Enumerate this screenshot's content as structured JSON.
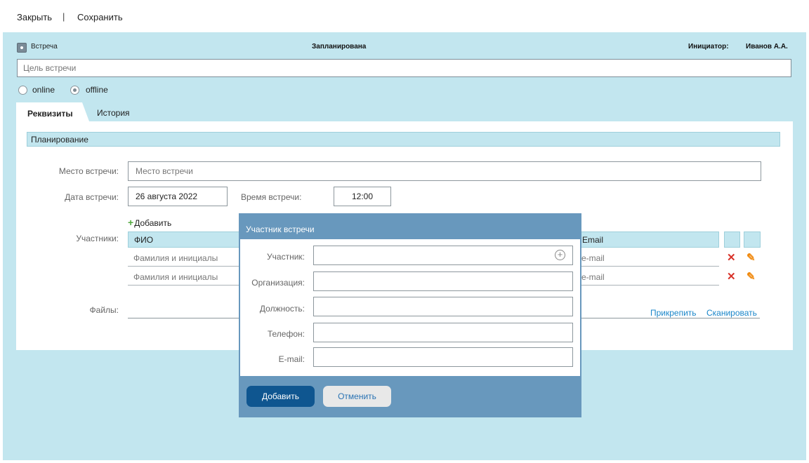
{
  "toolbar": {
    "close_label": "Закрыть",
    "separator": "|",
    "save_label": "Сохранить"
  },
  "header": {
    "doc_type": "Встреча",
    "status": "Запланирована",
    "initiator_label": "Инициатор:",
    "initiator_value": "Иванов А.А."
  },
  "purpose": {
    "placeholder": "Цель встречи",
    "value": ""
  },
  "format": {
    "options": [
      {
        "label": "online",
        "checked": false
      },
      {
        "label": "offline",
        "checked": true
      }
    ]
  },
  "tabs": [
    {
      "label": "Реквизиты",
      "active": true
    },
    {
      "label": "История",
      "active": false
    }
  ],
  "planning": {
    "section_title": "Планирование",
    "place_label": "Место встречи:",
    "place_placeholder": "Место встречи",
    "date_label": "Дата встречи:",
    "date_value": "26 августа 2022",
    "time_label": "Время встречи:",
    "time_value": "12:00",
    "participants_label": "Участники:",
    "add_label": "Добавить",
    "columns": {
      "fio": "ФИО",
      "email": "Email"
    },
    "rows": [
      {
        "fio": "Фамилия  и инициалы",
        "email": "e-mail"
      },
      {
        "fio": "Фамилия  и инициалы",
        "email": "e-mail"
      }
    ],
    "files_label": "Файлы:",
    "attach_label": "Прикрепить",
    "scan_label": "Сканировать"
  },
  "modal": {
    "title": "Участник встречи",
    "fields": [
      {
        "label": "Участник:"
      },
      {
        "label": "Организация:"
      },
      {
        "label": "Должность:"
      },
      {
        "label": "Телефон:"
      },
      {
        "label": "E-mail:"
      }
    ],
    "add_button": "Добавить",
    "cancel_button": "Отменить"
  },
  "colors": {
    "background": "#c2e6ef",
    "modal": "#6898bd",
    "primary_button": "#0f5690",
    "link": "#1a86c9",
    "delete": "#d8332a",
    "edit": "#f08a10",
    "add_plus": "#53a93f"
  },
  "icons": {
    "delete": "close-x-icon",
    "edit": "pencil-icon",
    "participant_add": "plus-circle-icon",
    "doc": "meeting-icon"
  }
}
